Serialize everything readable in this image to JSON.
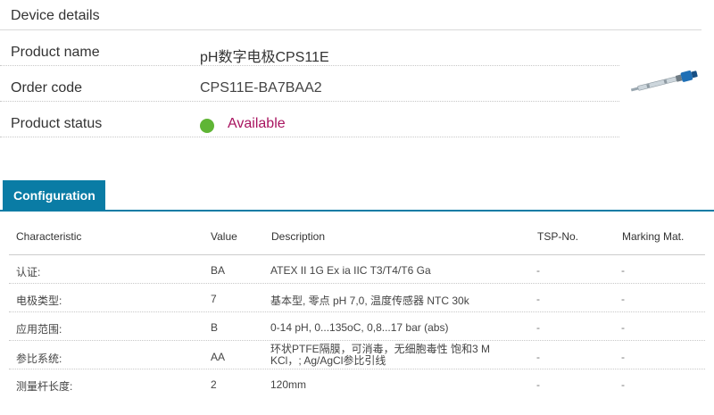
{
  "device_details": {
    "title": "Device details",
    "product_name_label": "Product name",
    "product_name_value": "pH数字电极CPS11E",
    "order_code_label": "Order code",
    "order_code_value": "CPS11E-BA7BAA2",
    "product_status_label": "Product status",
    "product_status_value": "Available",
    "status_color": "#5fb535",
    "status_text_color": "#a8135f",
    "image_icon": "ph-electrode-product-image"
  },
  "tabs": [
    {
      "label": "Configuration",
      "active": true
    }
  ],
  "accent_color": "#0a7ca5",
  "table": {
    "headers": {
      "characteristic": "Characteristic",
      "value": "Value",
      "description": "Description",
      "tsp": "TSP-No.",
      "marking": "Marking Mat."
    },
    "rows": [
      {
        "characteristic": "认证:",
        "value": "BA",
        "description": "ATEX II 1G Ex ia IIC T3/T4/T6 Ga",
        "tsp": "-",
        "marking": "-"
      },
      {
        "characteristic": "电极类型:",
        "value": "7",
        "description": "基本型, 零点 pH 7,0, 温度传感器 NTC 30k",
        "tsp": "-",
        "marking": "-"
      },
      {
        "characteristic": "应用范围:",
        "value": "B",
        "description": "0-14 pH, 0...135oC, 0,8...17 bar (abs)",
        "tsp": "-",
        "marking": "-"
      },
      {
        "characteristic": "参比系统:",
        "value": "AA",
        "description_line1": "环状PTFE隔膜，可消毒，无细胞毒性 饱和3 M",
        "description_line2": "KCl，; Ag/AgCl参比引线",
        "tsp": "-",
        "marking": "-"
      },
      {
        "characteristic": "测量杆长度:",
        "value": "2",
        "description": "120mm",
        "tsp": "-",
        "marking": "-"
      }
    ]
  }
}
